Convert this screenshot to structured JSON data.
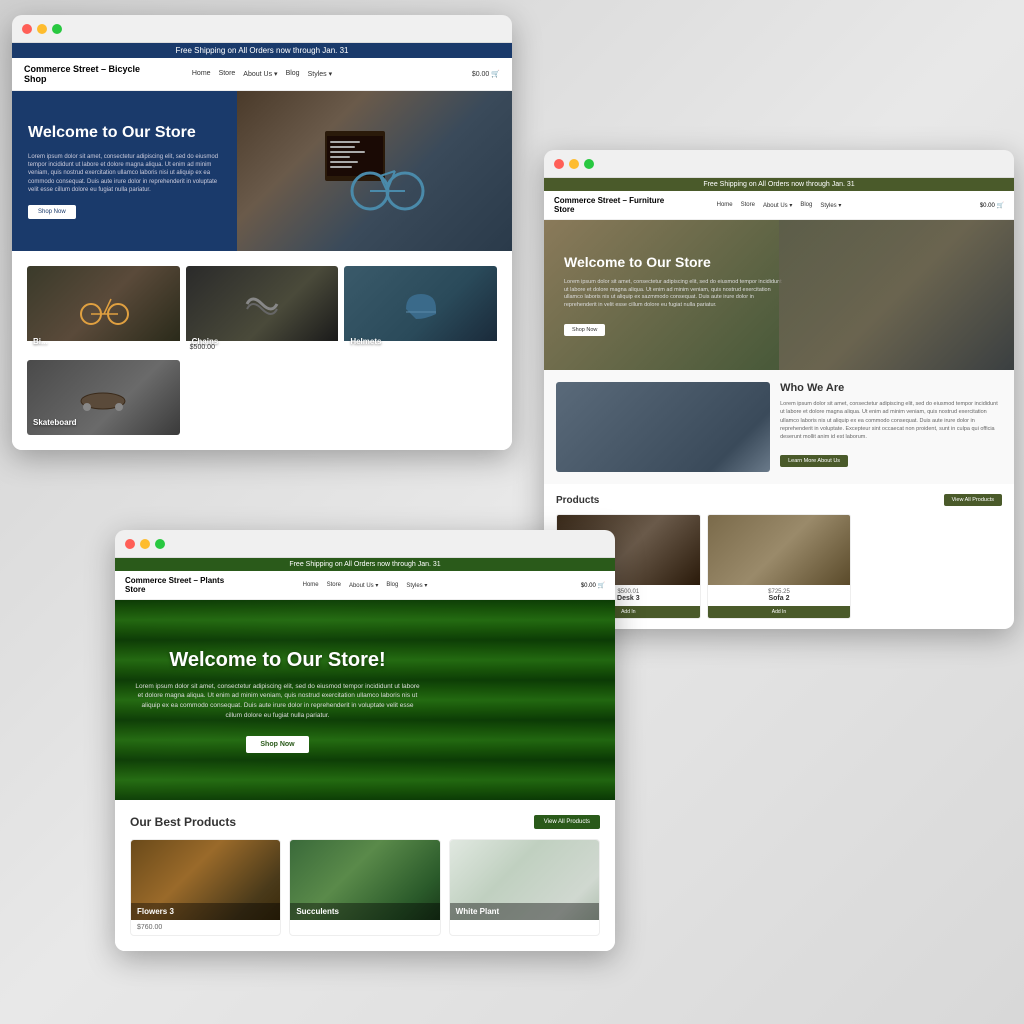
{
  "background": {
    "color": "#e0e0e0"
  },
  "bicycle_shop": {
    "topbar": "Free Shipping on All Orders now through Jan. 31",
    "nav": {
      "logo": "Commerce Street – Bicycle Shop",
      "links": [
        "Home",
        "Store",
        "About Us ▾",
        "Blog",
        "Styles ▾"
      ],
      "account": "$0.00 🛒"
    },
    "hero": {
      "title": "Welcome to Our Store",
      "text": "Lorem ipsum dolor sit amet, consectetur adipiscing elit, sed do eiusmod tempor incididunt ut labore et dolore magna aliqua. Ut enim ad minim veniam, quis nostrud exercitation ullamco laboris nisi ut aliquip ex ea commodo consequat. Duis aute irure dolor in reprehenderit in voluptate velit esse cillum dolore eu fugiat nulla pariatur.",
      "button": "Shop Now"
    },
    "products": [
      {
        "name": "Bicycle",
        "price": ""
      },
      {
        "name": "Chains",
        "price": "$500.00"
      },
      {
        "name": "Helmets",
        "price": ""
      },
      {
        "name": "Skateboard",
        "price": ""
      }
    ]
  },
  "furniture_shop": {
    "topbar": "Free Shipping on All Orders now through Jan. 31",
    "nav": {
      "logo": "Commerce Street – Furniture Store",
      "links": [
        "Home",
        "Store",
        "About Us ▾",
        "Blog",
        "Styles ▾"
      ],
      "account": "$0.00 🛒"
    },
    "hero": {
      "title": "Welcome to Our Store",
      "text": "Lorem ipsum dolor sit amet, consectetur adipiscing elit, sed do eiusmod tempor incididunt ut labore et dolore magna aliqua. Ut enim ad minim veniam, quis nostrud exercitation ullamco laboris nis ut aliquip ex sazmmodo consequat. Duis aute irure dolor in reprehenderit in velit esse cillum dolore eu fugiat nulla pariatur.",
      "button": "Shop Now"
    },
    "who_we_are": {
      "title": "Who We Are",
      "text": "Lorem ipsum dolor sit amet, consectetur adipiscing elit, sed do eiusmod tempor incididunt ut labore et dolore magna aliqua. Ut enim ad minim veniam, quis nostrud exercitation ullamco laboris nis ut aliquip ex ea commodo consequat. Duis aute irure dolor in reprehenderit in voluptate. Excepteur sint occaecat non proident, sunt in culpa qui officia deserunt mollit anim id est laborum.",
      "button": "Learn More About Us"
    },
    "products": {
      "title": "Products",
      "view_all": "View All Products",
      "items": [
        {
          "name": "Desk 3",
          "price": "$500.01"
        },
        {
          "name": "Sofa 2",
          "price": "$725.25"
        }
      ]
    }
  },
  "plants_shop": {
    "topbar": "Free Shipping on All Orders now through Jan. 31",
    "nav": {
      "logo": "Commerce Street – Plants Store",
      "links": [
        "Home",
        "Store",
        "About Us ▾",
        "Blog",
        "Styles ▾"
      ],
      "account": "$0.00 🛒"
    },
    "hero": {
      "title": "Welcome to Our Store!",
      "text": "Lorem ipsum dolor sit amet, consectetur adipiscing elit, sed do eiusmod tempor incididunt ut labore et dolore magna aliqua. Ut enim ad minim veniam, quis nostrud exercitation ullamco laboris nis ut aliquip ex ea commodo consequat. Duis aute irure dolor in reprehenderit in voluptate velit esse cillum dolore eu fugiat nulla pariatur.",
      "button": "Shop Now"
    },
    "products": {
      "title": "Our Best Products",
      "view_all": "View All Products",
      "items": [
        {
          "name": "Flowers 3",
          "price": "$760.00"
        },
        {
          "name": "Succulents",
          "price": ""
        },
        {
          "name": "White Plant",
          "price": ""
        }
      ]
    }
  }
}
